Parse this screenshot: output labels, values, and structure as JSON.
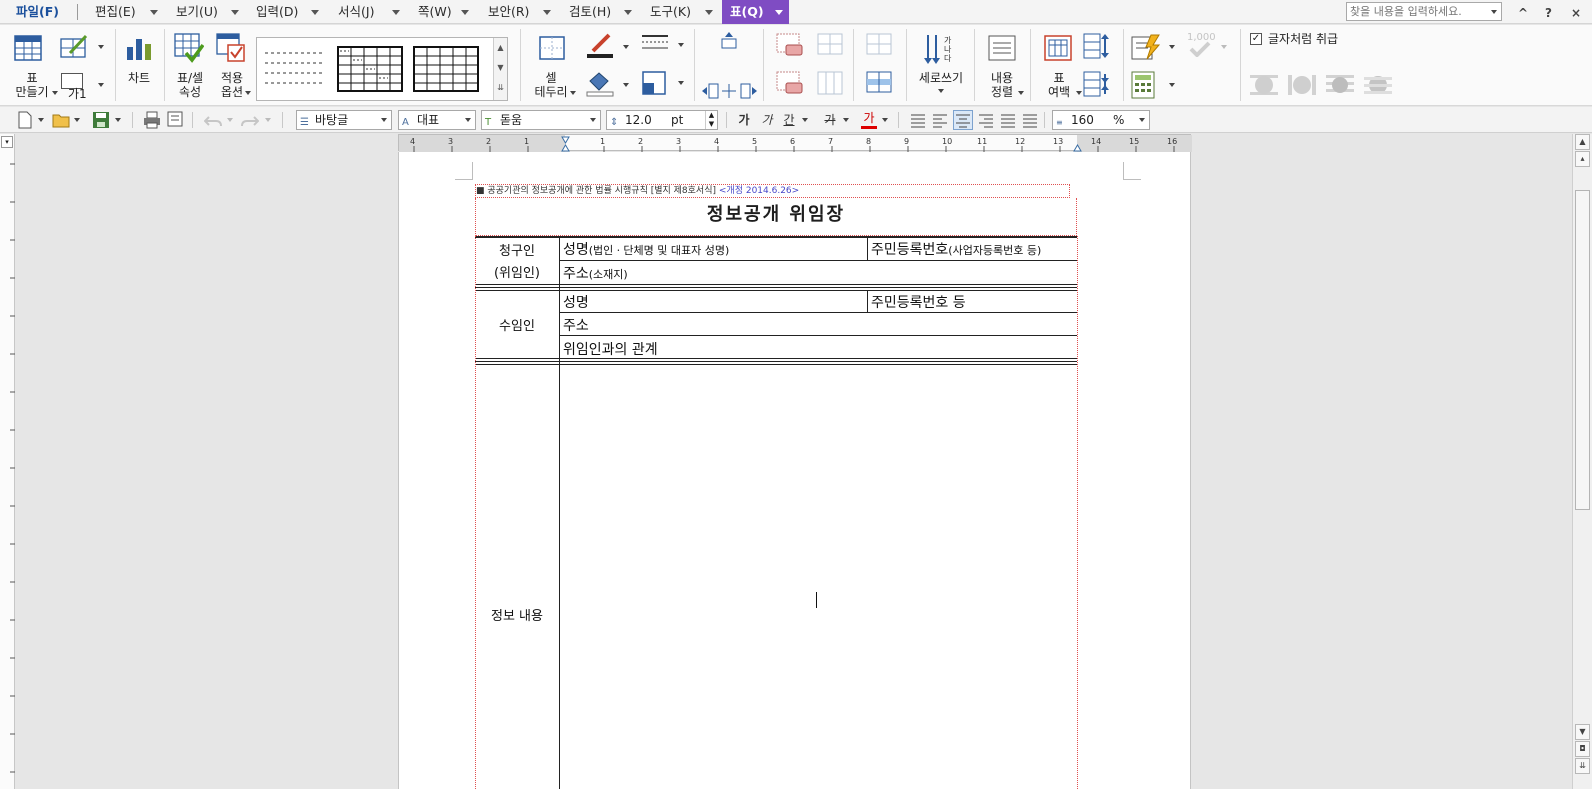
{
  "menubar": {
    "items": [
      {
        "label": "파일(F)"
      },
      {
        "label": "편집(E)"
      },
      {
        "label": "보기(U)"
      },
      {
        "label": "입력(D)"
      },
      {
        "label": "서식(J)"
      },
      {
        "label": "쪽(W)"
      },
      {
        "label": "보안(R)"
      },
      {
        "label": "검토(H)"
      },
      {
        "label": "도구(K)"
      },
      {
        "label": "표(Q)"
      }
    ],
    "search_placeholder": "찾을 내용을 입력하세요.",
    "window_buttons": [
      "^",
      "?",
      "×"
    ]
  },
  "ribbon": {
    "table_make": "표\n만들기",
    "char_style": "가1",
    "chart": "차트",
    "table_cell_props": "표/셀\n속성",
    "apply_options": "적용\n옵션",
    "cell_border": "셀\n테두리",
    "vertical_writing": "세로쓰기",
    "content_align": "내용\n정렬",
    "table_margin": "표\n여백",
    "number_sample": "1,000",
    "treat_as_char": "글자처럼 취급",
    "treat_as_char_checked": true
  },
  "formatbar": {
    "style": "바탕글",
    "lang": "대표",
    "font": "돋움",
    "font_size": "12.0",
    "font_unit": "pt",
    "line_spacing": "160",
    "line_spacing_unit": "%",
    "char_buttons": [
      "가",
      "가",
      "간",
      "가",
      "가"
    ]
  },
  "ruler": {
    "h_numbers": [
      "4",
      "3",
      "2",
      "1",
      "1",
      "2",
      "3",
      "4",
      "5",
      "6",
      "7",
      "8",
      "9",
      "10",
      "11",
      "12",
      "13",
      "14",
      "15",
      "16"
    ]
  },
  "document": {
    "header_line": "■ 공공기관의 정보공개에 관한 법률 시행규칙 [별지 제8호서식]",
    "header_rev": "<개정 2014.6.26>",
    "title": "정보공개 위임장",
    "claimant_label_1": "청구인",
    "claimant_label_2": "(위임인)",
    "claimant_name": "성명",
    "claimant_name_note": "(법인ㆍ단체명 및 대표자 성명)",
    "claimant_id": "주민등록번호",
    "claimant_id_note": "(사업자등록번호 등)",
    "claimant_addr": "주소",
    "claimant_addr_note": "(소재지)",
    "delegate_label": "수임인",
    "delegate_name": "성명",
    "delegate_id": "주민등록번호 등",
    "delegate_addr": "주소",
    "delegate_relation": "위임인과의 관계",
    "info_label": "정보 내용"
  }
}
